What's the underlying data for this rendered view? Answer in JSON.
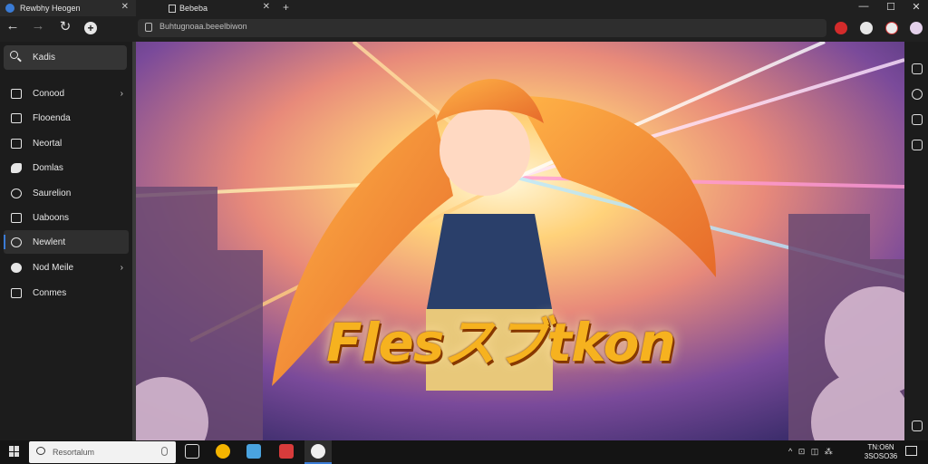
{
  "tabs": [
    {
      "label": "Rewbhy Heogen"
    },
    {
      "label": "Bebeba"
    }
  ],
  "window_controls": {
    "minimize": "—",
    "maximize": "☐",
    "close": "✕"
  },
  "nav": {
    "back": "←",
    "forward": "→",
    "reload": "↻",
    "new_tab": "+"
  },
  "address_bar": {
    "url": "Buhtugnoaa.beeelbiwon"
  },
  "sidebar": {
    "search_label": "Kadis",
    "items": [
      {
        "label": "Conood",
        "has_chevron": true
      },
      {
        "label": "Flooenda",
        "has_chevron": false
      },
      {
        "label": "Neortal",
        "has_chevron": false
      },
      {
        "label": "Domlas",
        "has_chevron": false
      },
      {
        "label": "Saurelion",
        "has_chevron": false
      },
      {
        "label": "Uaboons",
        "has_chevron": false
      },
      {
        "label": "Newlent",
        "has_chevron": false,
        "active": true
      },
      {
        "label": "Nod Meile",
        "has_chevron": true
      },
      {
        "label": "Conmes",
        "has_chevron": false
      }
    ],
    "chevron": "›"
  },
  "content": {
    "banner_title": "Flesスブtkon"
  },
  "taskbar": {
    "search_placeholder": "Resortalum",
    "tray": "^ ⊡ ◫ ⁂",
    "clock_time": "TN:O6N",
    "clock_date": "3SOSO36"
  },
  "colors": {
    "bar_bg": "#202020",
    "sidebar_bg": "#1c1c1c",
    "accent": "#3a7bd5",
    "banner_text": "#f6b21f"
  }
}
